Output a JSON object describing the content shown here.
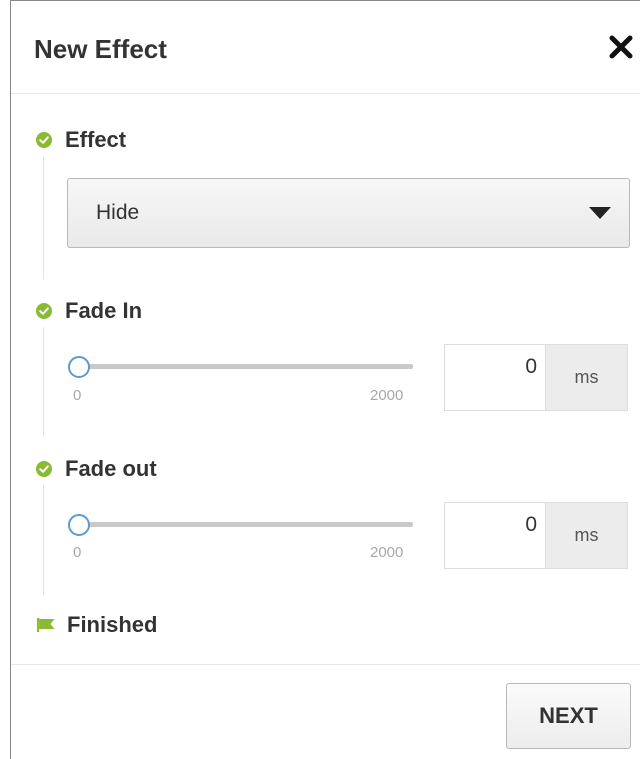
{
  "dialog": {
    "title": "New Effect",
    "close_icon": "close-icon"
  },
  "steps": {
    "effect": {
      "label": "Effect",
      "icon": "check-circle-icon"
    },
    "fade_in": {
      "label": "Fade In",
      "icon": "check-circle-icon"
    },
    "fade_out": {
      "label": "Fade out",
      "icon": "check-circle-icon"
    },
    "finished": {
      "label": "Finished",
      "icon": "flag-icon"
    }
  },
  "effect_select": {
    "value": "Hide",
    "icon": "caret-down-icon"
  },
  "fade_in": {
    "min": "0",
    "max": "2000",
    "value": "0",
    "unit": "ms",
    "position": 0
  },
  "fade_out": {
    "min": "0",
    "max": "2000",
    "value": "0",
    "unit": "ms",
    "position": 0
  },
  "footer": {
    "next_label": "NEXT"
  },
  "colors": {
    "accent_green": "#8ab934",
    "slider_blue": "#5b9bd5",
    "text": "#333333"
  }
}
